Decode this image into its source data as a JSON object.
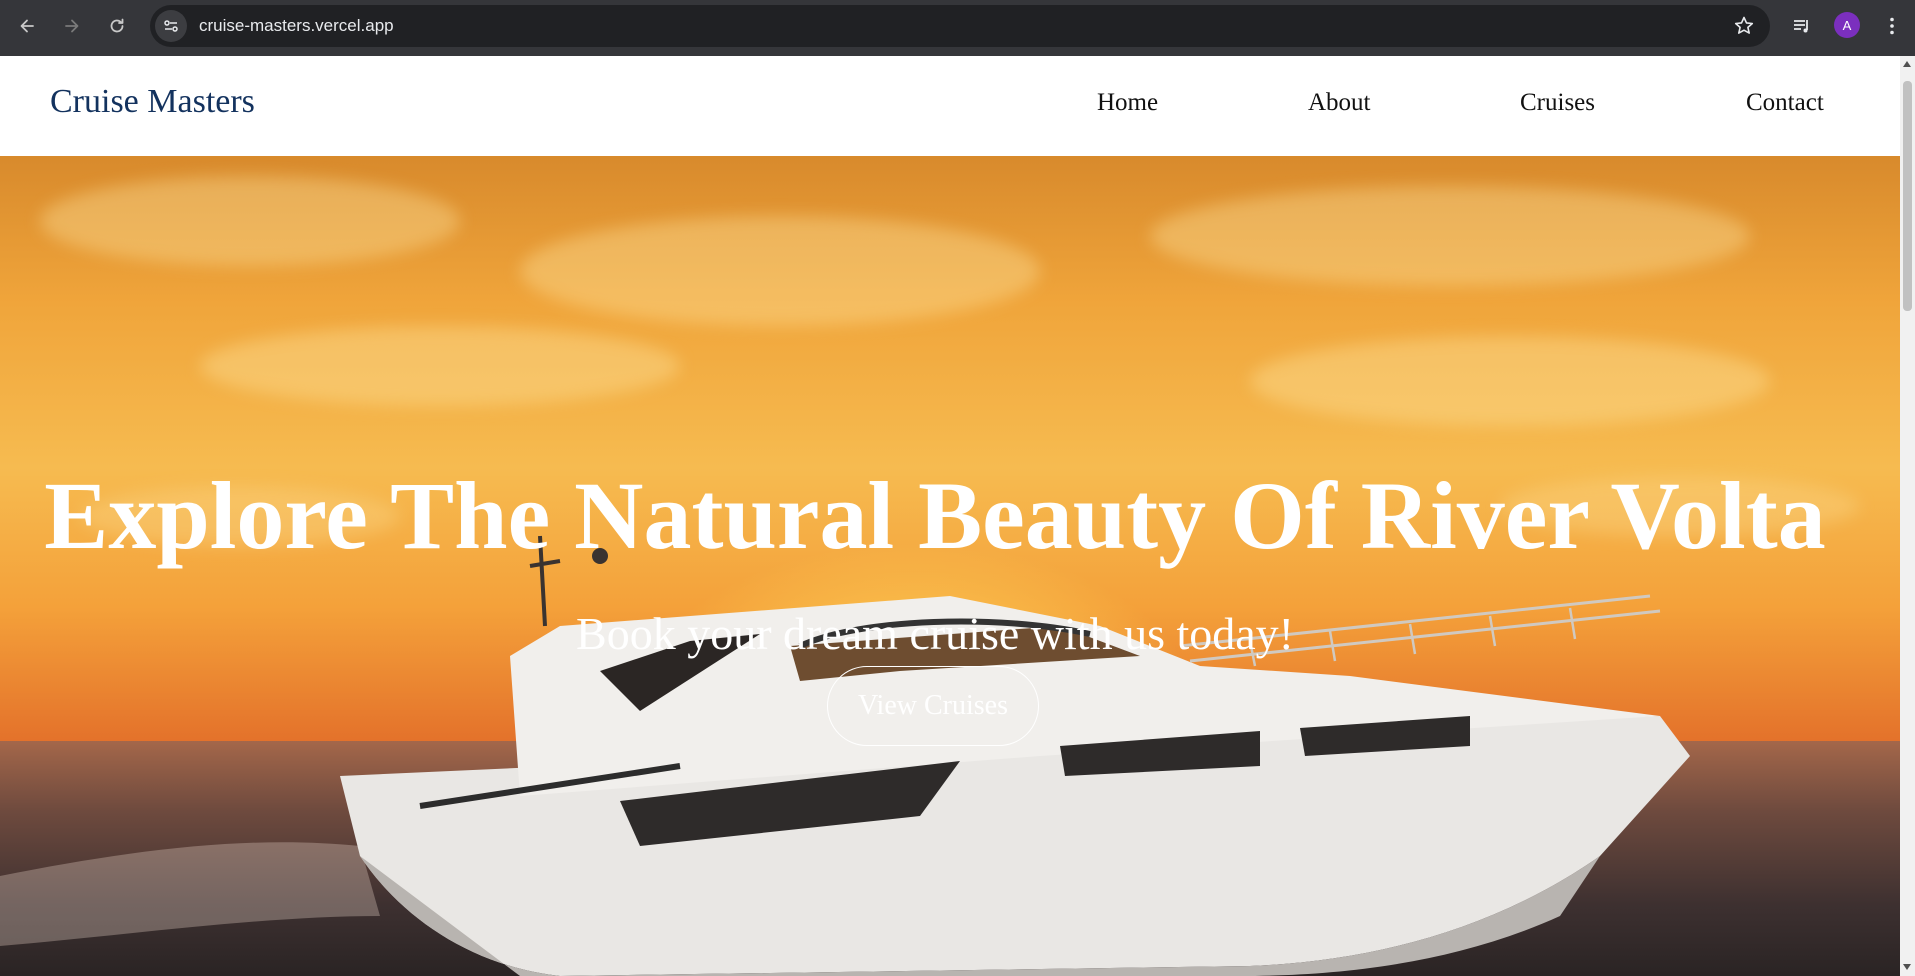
{
  "browser": {
    "url": "cruise-masters.vercel.app",
    "profile_initial": "A",
    "profile_color": "#7b2fbe",
    "icons": [
      "back-icon",
      "forward-icon",
      "reload-icon",
      "site-info-icon",
      "bookmark-star-icon",
      "media-control-icon",
      "menu-kebab-icon"
    ]
  },
  "site": {
    "brand": "Cruise Masters",
    "brand_color": "#13325e",
    "nav": [
      {
        "label": "Home"
      },
      {
        "label": "About"
      },
      {
        "label": "Cruises"
      },
      {
        "label": "Contact"
      }
    ]
  },
  "hero": {
    "title": "Explore The Natural Beauty Of River Volta",
    "subtitle": "Book your dream cruise with us today!",
    "cta_label": "View Cruises"
  }
}
